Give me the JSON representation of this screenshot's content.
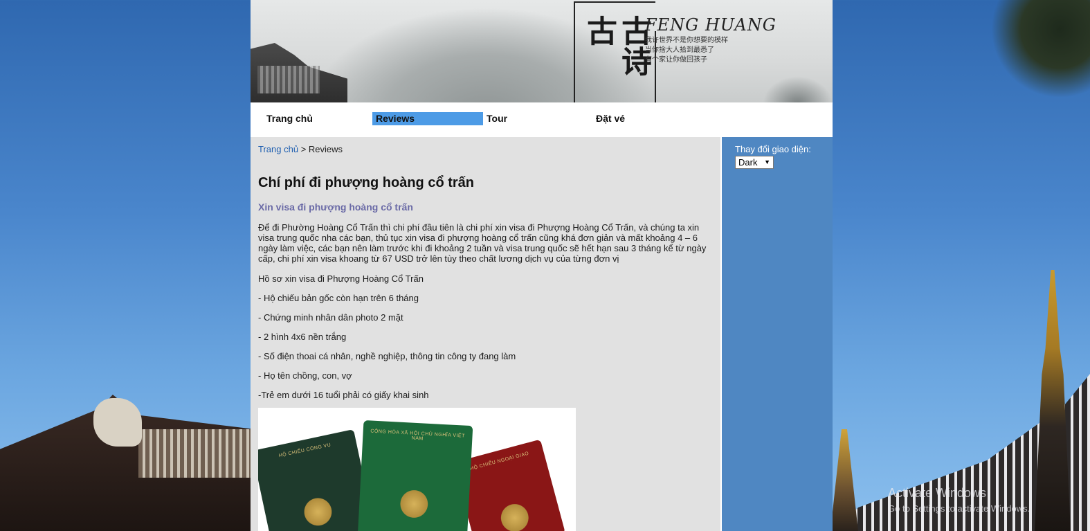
{
  "banner": {
    "calligraphy": "古诗古",
    "title": "FENG HUANG",
    "subtitle_lines": [
      "我许世界不是你想要的模样",
      "当你捨大人拾到最悉了",
      "有个家让你做回孩子"
    ]
  },
  "nav": {
    "items": [
      {
        "label": "Trang chủ",
        "active": false
      },
      {
        "label": "Reviews",
        "active": true
      },
      {
        "label": "Tour",
        "active": false
      },
      {
        "label": "Đặt vé",
        "active": false
      }
    ],
    "active_color": "#4d9be6"
  },
  "breadcrumb": {
    "home": "Trang chủ",
    "separator": ">",
    "current": "Reviews"
  },
  "article": {
    "title": "Chí phí đi phượng hoàng cổ trấn",
    "subtitle": "Xin visa đi phượng hoàng cổ trấn",
    "intro": "Để đi Phường Hoàng Cổ Trấn thì chi phí đầu tiên là chi phí xin visa đi Phượng Hoàng Cổ Trấn, và chúng ta xin visa trung quốc nha các bạn, thủ tục xin visa đi phượng hoàng cổ trấn cũng khá đơn giản và mất khoảng 4 – 6 ngày làm việc, các bạn nên làm trước khi đi khoảng 2 tuần và visa trung quốc sẽ hết hạn sau 3 tháng kể từ ngày cấp, chi phí xin visa khoang từ 67 USD trở lên tùy theo chất lương dịch vụ của từng đơn vị",
    "docs_heading": "Hồ sơ xin visa đi Phượng Hoàng Cổ Trấn",
    "docs": [
      "- Hộ chiếu bản gốc còn hạn trên 6 tháng",
      "- Chứng minh nhân dân photo 2 mặt",
      "- 2 hình 4x6 nền trắng",
      "- Số điện thoai cá nhân, nghề nghiệp, thông tin công ty đang làm",
      "- Họ tên chồng, con, vợ",
      "-Trẻ em dưới 16 tuổi phải có giấy khai sinh"
    ],
    "image": {
      "passport_texts": [
        "HỘ CHIẾU CÔNG VỤ",
        "CỘNG HÒA XÃ HỘI CHỦ NGHĨA VIỆT NAM",
        "HỘ CHIẾU NGOẠI GIAO"
      ]
    }
  },
  "sidebar": {
    "label": "Thay đổi giao diện:",
    "theme_value": "Dark",
    "background": "#4f87c2"
  },
  "watermark": {
    "line1": "Activate Windows",
    "line2": "Go to Settings to activate Windows."
  }
}
